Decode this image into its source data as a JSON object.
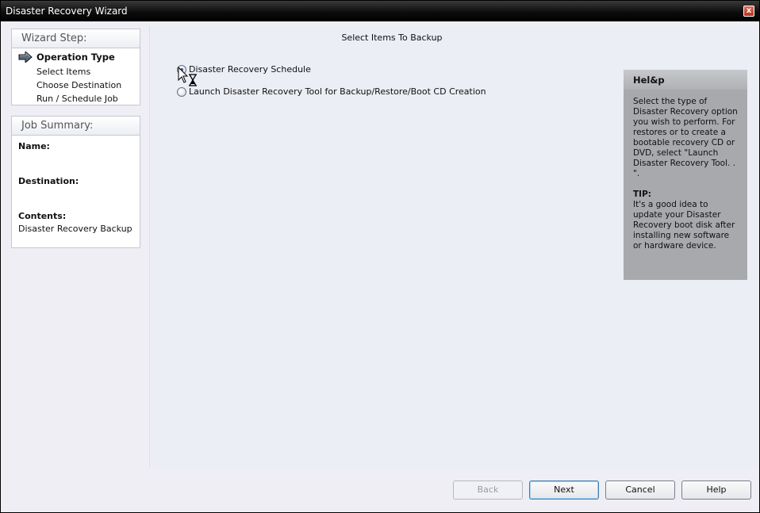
{
  "window": {
    "title": "Disaster Recovery Wizard",
    "close_label": "x"
  },
  "wizard": {
    "header": "Wizard Step:",
    "steps": [
      {
        "label": "Operation Type"
      },
      {
        "label": "Select Items"
      },
      {
        "label": "Choose Destination"
      },
      {
        "label": "Run / Schedule Job"
      }
    ]
  },
  "summary": {
    "header": "Job Summary:",
    "name_label": "Name:",
    "name_value": "",
    "destination_label": "Destination:",
    "destination_value": "",
    "contents_label": "Contents:",
    "contents_value": "Disaster Recovery Backup"
  },
  "main": {
    "title": "Select Items To Backup",
    "options": [
      {
        "label": "Disaster Recovery Schedule",
        "checked": true
      },
      {
        "label": "Launch Disaster Recovery Tool for Backup/Restore/Boot CD Creation",
        "checked": false
      }
    ]
  },
  "help": {
    "header": "Hel&p",
    "text": "Select the type of Disaster Recovery option you wish to perform.  For restores or to create a bootable recovery CD or DVD, select \"Launch Disaster Recovery Tool. . \".",
    "tip_label": "TIP:",
    "tip_text": "It's a good idea to update your Disaster Recovery boot disk after installing new software or hardware device."
  },
  "buttons": {
    "back": "Back",
    "next": "Next",
    "cancel": "Cancel",
    "help": "Help"
  }
}
